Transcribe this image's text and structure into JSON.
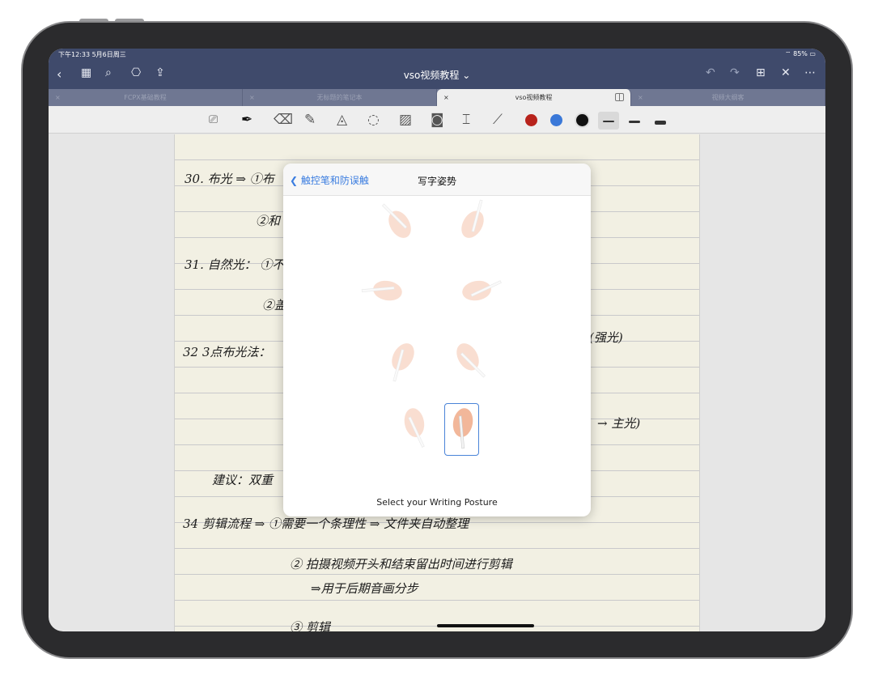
{
  "status": {
    "time": "下午12:33  5月6日周三",
    "battery": "85%"
  },
  "nav": {
    "title": "vso视频教程 ⌄",
    "icons": [
      "back-icon",
      "grid-icon",
      "search-icon",
      "bookmark-icon",
      "share-icon",
      "undo-icon",
      "redo-icon",
      "add-page-icon",
      "close-icon",
      "more-icon"
    ]
  },
  "tabs": [
    {
      "label": "FCPX基础教程"
    },
    {
      "label": "无标题的笔记本"
    },
    {
      "label": "vso视频教程",
      "active": true
    },
    {
      "label": "视频大纲客"
    }
  ],
  "toolbar": {
    "tools": [
      "readonly-icon",
      "pen-icon",
      "eraser-icon",
      "highlighter-icon",
      "shapes-icon",
      "lasso-icon",
      "image-icon",
      "camera-icon",
      "text-icon",
      "laser-icon"
    ],
    "colors": [
      "#b8231c",
      "#3a78d8",
      "#111111"
    ],
    "stroke_widths": [
      "thin",
      "medium",
      "thick"
    ],
    "selected_width": "thin"
  },
  "notes": {
    "lines": [
      "30. 布光 ⇒ ①布",
      "②和",
      "31. 自然光： ①不",
      "②盖",
      "32  3点布光法：",
      "(强光)",
      "→ 主光)",
      "建议：双重",
      "34 剪辑流程 ⇒ ①需要一个条理性 ⇒ 文件夹自动整理",
      "② 拍摄视频开头和结束留出时间进行剪辑",
      "⇒用于后期音画分步",
      "③ 剪辑"
    ]
  },
  "modal": {
    "back_label": "触控笔和防误触",
    "title": "写字姿势",
    "caption": "Select your Writing Posture",
    "postures": 8,
    "selected_posture": 8
  }
}
